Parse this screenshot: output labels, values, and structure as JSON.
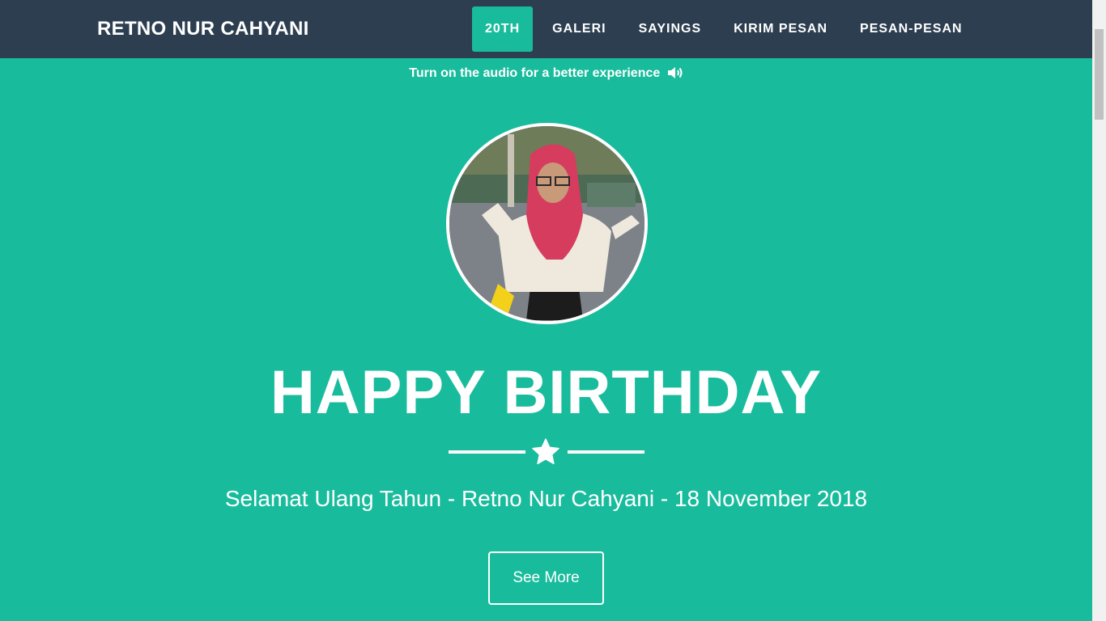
{
  "navbar": {
    "brand": "RETNO NUR CAHYANI",
    "items": [
      {
        "label": "20TH",
        "active": true
      },
      {
        "label": "GALERI",
        "active": false
      },
      {
        "label": "SAYINGS",
        "active": false
      },
      {
        "label": "KIRIM PESAN",
        "active": false
      },
      {
        "label": "PESAN-PESAN",
        "active": false
      }
    ]
  },
  "header": {
    "audio_note": "Turn on the audio for a better experience",
    "audio_icon": "volume-up-icon",
    "avatar_icon": "profile-photo",
    "title": "HAPPY BIRTHDAY",
    "divider_icon": "star-icon",
    "subtitle": "Selamat Ulang Tahun - Retno Nur Cahyani - 18 November 2018",
    "cta_label": "See More"
  },
  "colors": {
    "primary": "#18BC9C",
    "navbar": "#2C3E50",
    "text": "#FFFFFF"
  }
}
